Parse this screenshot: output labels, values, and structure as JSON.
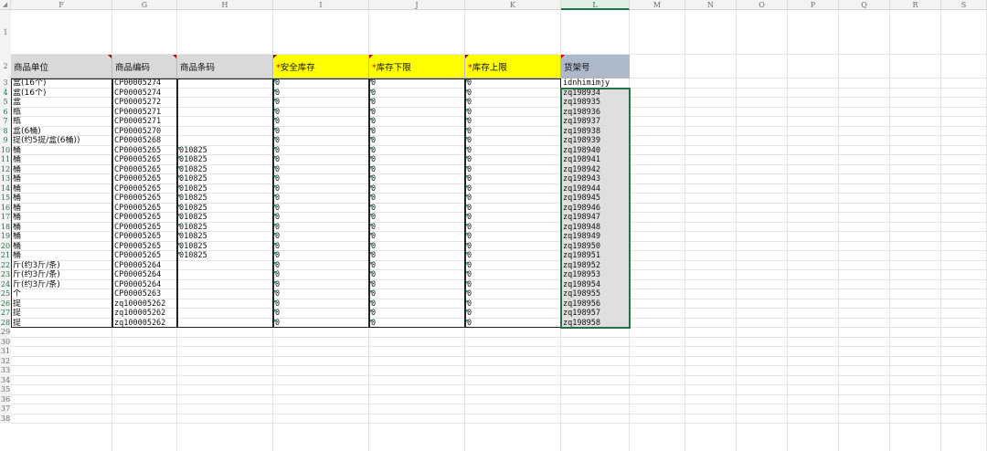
{
  "column_headers": [
    {
      "id": "corner",
      "label": "◢"
    },
    {
      "id": "F",
      "label": "F"
    },
    {
      "id": "G",
      "label": "G"
    },
    {
      "id": "H",
      "label": "H"
    },
    {
      "id": "I",
      "label": "I"
    },
    {
      "id": "J",
      "label": "J"
    },
    {
      "id": "K",
      "label": "K"
    },
    {
      "id": "L",
      "label": "L"
    },
    {
      "id": "M",
      "label": "M"
    },
    {
      "id": "N",
      "label": "N"
    },
    {
      "id": "O",
      "label": "O"
    },
    {
      "id": "P",
      "label": "P"
    },
    {
      "id": "Q",
      "label": "Q"
    },
    {
      "id": "R",
      "label": "R"
    },
    {
      "id": "S",
      "label": "S"
    }
  ],
  "row_numbers": [
    "1",
    "2",
    "3",
    "4",
    "5",
    "6",
    "7",
    "8",
    "9",
    "10",
    "11",
    "12",
    "13",
    "14",
    "15",
    "16",
    "17",
    "18",
    "19",
    "20",
    "21",
    "22",
    "23",
    "24",
    "25",
    "26",
    "27",
    "28",
    "29",
    "30",
    "31",
    "32",
    "33",
    "34",
    "35",
    "36",
    "37",
    "38"
  ],
  "headers": {
    "unit": "商品单位",
    "code": "商品编码",
    "barcode": "商品条码",
    "safety_stock_star": "*",
    "safety_stock": "安全库存",
    "stock_min_star": "*",
    "stock_min": "库存下限",
    "stock_max_star": "*",
    "stock_max": "库存上限",
    "shelf_no": "货架号"
  },
  "rows": [
    {
      "unit": "盒(16个)",
      "code": "CP00005274",
      "barcode": "",
      "safety": "0",
      "min": "0",
      "max": "0",
      "shelf": "idnhimimjy"
    },
    {
      "unit": "盒(16个)",
      "code": "CP00005274",
      "barcode": "",
      "safety": "0",
      "min": "0",
      "max": "0",
      "shelf": "zq198934"
    },
    {
      "unit": "盒",
      "code": "CP00005272",
      "barcode": "",
      "safety": "0",
      "min": "0",
      "max": "0",
      "shelf": "zq198935"
    },
    {
      "unit": "瓶",
      "code": "CP00005271",
      "barcode": "",
      "safety": "0",
      "min": "0",
      "max": "0",
      "shelf": "zq198936"
    },
    {
      "unit": "瓶",
      "code": "CP00005271",
      "barcode": "",
      "safety": "0",
      "min": "0",
      "max": "0",
      "shelf": "zq198937"
    },
    {
      "unit": "盒(6桶)",
      "code": "CP00005270",
      "barcode": "",
      "safety": "0",
      "min": "0",
      "max": "0",
      "shelf": "zq198938"
    },
    {
      "unit": "提(约5提/盒(6桶))",
      "code": "CP00005268",
      "barcode": "",
      "safety": "0",
      "min": "0",
      "max": "0",
      "shelf": "zq198939"
    },
    {
      "unit": "桶",
      "code": "CP00005265",
      "barcode": "010825",
      "safety": "0",
      "min": "0",
      "max": "0",
      "shelf": "zq198940"
    },
    {
      "unit": "桶",
      "code": "CP00005265",
      "barcode": "010825",
      "safety": "0",
      "min": "0",
      "max": "0",
      "shelf": "zq198941"
    },
    {
      "unit": "桶",
      "code": "CP00005265",
      "barcode": "010825",
      "safety": "0",
      "min": "0",
      "max": "0",
      "shelf": "zq198942"
    },
    {
      "unit": "桶",
      "code": "CP00005265",
      "barcode": "010825",
      "safety": "0",
      "min": "0",
      "max": "0",
      "shelf": "zq198943"
    },
    {
      "unit": "桶",
      "code": "CP00005265",
      "barcode": "010825",
      "safety": "0",
      "min": "0",
      "max": "0",
      "shelf": "zq198944"
    },
    {
      "unit": "桶",
      "code": "CP00005265",
      "barcode": "010825",
      "safety": "0",
      "min": "0",
      "max": "0",
      "shelf": "zq198945"
    },
    {
      "unit": "桶",
      "code": "CP00005265",
      "barcode": "010825",
      "safety": "0",
      "min": "0",
      "max": "0",
      "shelf": "zq198946"
    },
    {
      "unit": "桶",
      "code": "CP00005265",
      "barcode": "010825",
      "safety": "0",
      "min": "0",
      "max": "0",
      "shelf": "zq198947"
    },
    {
      "unit": "桶",
      "code": "CP00005265",
      "barcode": "010825",
      "safety": "0",
      "min": "0",
      "max": "0",
      "shelf": "zq198948"
    },
    {
      "unit": "桶",
      "code": "CP00005265",
      "barcode": "010825",
      "safety": "0",
      "min": "0",
      "max": "0",
      "shelf": "zq198949"
    },
    {
      "unit": "桶",
      "code": "CP00005265",
      "barcode": "010825",
      "safety": "0",
      "min": "0",
      "max": "0",
      "shelf": "zq198950"
    },
    {
      "unit": "桶",
      "code": "CP00005265",
      "barcode": "010825",
      "safety": "0",
      "min": "0",
      "max": "0",
      "shelf": "zq198951"
    },
    {
      "unit": "斤(约3斤/条)",
      "code": "CP00005264",
      "barcode": "",
      "safety": "0",
      "min": "0",
      "max": "0",
      "shelf": "zq198952"
    },
    {
      "unit": "斤(约3斤/条)",
      "code": "CP00005264",
      "barcode": "",
      "safety": "0",
      "min": "0",
      "max": "0",
      "shelf": "zq198953"
    },
    {
      "unit": "斤(约3斤/条)",
      "code": "CP00005264",
      "barcode": "",
      "safety": "0",
      "min": "0",
      "max": "0",
      "shelf": "zq198954"
    },
    {
      "unit": "个",
      "code": "CP00005263",
      "barcode": "",
      "safety": "0",
      "min": "0",
      "max": "0",
      "shelf": "zq198955"
    },
    {
      "unit": "提",
      "code": "zq100005262",
      "barcode": "",
      "safety": "0",
      "min": "0",
      "max": "0",
      "shelf": "zq198956"
    },
    {
      "unit": "提",
      "code": "zq100005262",
      "barcode": "",
      "safety": "0",
      "min": "0",
      "max": "0",
      "shelf": "zq198957"
    },
    {
      "unit": "提",
      "code": "zq100005262",
      "barcode": "",
      "safety": "0",
      "min": "0",
      "max": "0",
      "shelf": "zq198958"
    }
  ],
  "colors": {
    "header_gray": "#d9d9d9",
    "header_yellow": "#ffff00",
    "header_blue": "#acb9ca",
    "required_star": "#e00000",
    "selection_green": "#217346"
  }
}
